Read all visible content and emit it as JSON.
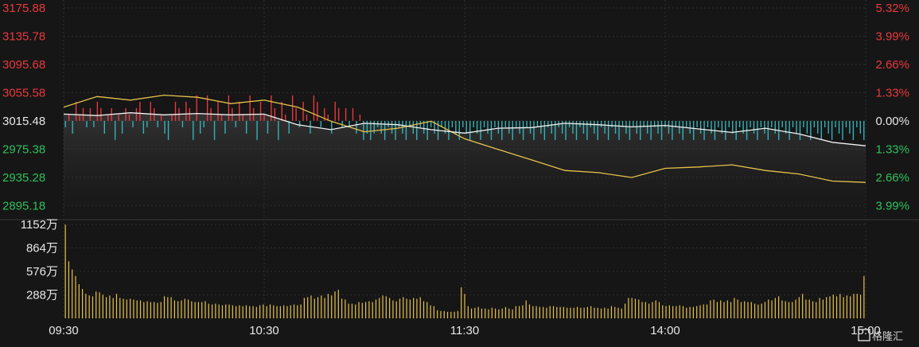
{
  "chart_data": [
    {
      "type": "line",
      "title": "",
      "xlabel": "",
      "ylabel": "",
      "base_price": 3015.48,
      "y_left_ticks": [
        "3175.88",
        "3135.78",
        "3095.68",
        "3055.58",
        "3015.48",
        "2975.38",
        "2935.28",
        "2895.18"
      ],
      "y_right_ticks": [
        "5.32%",
        "3.99%",
        "2.66%",
        "1.33%",
        "0.00%",
        "1.33%",
        "2.66%",
        "3.99%"
      ],
      "x_ticks": [
        "09:30",
        "10:30",
        "11:30",
        "14:00",
        "15:00"
      ],
      "ylim": [
        2875.13,
        3175.88
      ],
      "series": [
        {
          "x": [
            0,
            10,
            20,
            30,
            40,
            50,
            60,
            70,
            80,
            90,
            100,
            110,
            120,
            130,
            140,
            150,
            160,
            170,
            180,
            190,
            200,
            210,
            220,
            230,
            240
          ],
          "values": [
            3035,
            3050,
            3045,
            3052,
            3049,
            3040,
            3045,
            3035,
            3015,
            3000,
            3005,
            3015,
            2990,
            2975,
            2960,
            2945,
            2942,
            2935,
            2948,
            2950,
            2953,
            2945,
            2940,
            2930,
            2928
          ]
        },
        {
          "x": [
            0,
            10,
            20,
            30,
            40,
            50,
            60,
            70,
            80,
            90,
            100,
            110,
            120,
            130,
            140,
            150,
            160,
            170,
            180,
            190,
            200,
            210,
            220,
            230,
            240
          ],
          "values": [
            3025,
            3023,
            3027,
            3024,
            3026,
            3024,
            3025,
            3010,
            3003,
            3012,
            3010,
            3003,
            2998,
            3005,
            3006,
            3012,
            3010,
            3007,
            3009,
            3004,
            2999,
            3005,
            2997,
            2985,
            2980
          ]
        }
      ],
      "breadth_bars": [
        -1,
        1,
        -2,
        3,
        1,
        2,
        -1,
        2,
        -1,
        3,
        2,
        -2,
        1,
        2,
        -3,
        1,
        -2,
        2,
        1,
        -1,
        2,
        3,
        -2,
        -1,
        3,
        2,
        -1,
        1,
        -2,
        -3,
        1,
        3,
        2,
        -1,
        3,
        2,
        -3,
        4,
        -2,
        -1,
        4,
        2,
        -3,
        3,
        1,
        -2,
        4,
        2,
        -1,
        3,
        1,
        -2,
        4,
        2,
        -3,
        3,
        1,
        -2,
        4,
        2,
        -3,
        3,
        1,
        -2,
        4,
        2,
        -1,
        3,
        1,
        -2,
        4,
        3,
        -1,
        2,
        1,
        -2,
        3,
        2,
        -1,
        2,
        -1,
        2,
        -2,
        1,
        -3,
        -2,
        -3,
        -2,
        -1,
        -2,
        -3,
        -1,
        -2,
        -3,
        -1,
        -2,
        -3,
        -1,
        -2,
        -3,
        -1,
        -2,
        -3,
        -1,
        -2,
        -3,
        -1,
        -2,
        -3,
        -1,
        -2,
        -3,
        -1,
        -2,
        -3,
        -1,
        -2,
        -3,
        -1,
        -2,
        -3,
        -1,
        -2,
        -3,
        -1,
        -2,
        -3,
        -1,
        -2,
        -3,
        -1,
        -2,
        -3,
        -1,
        -2,
        -3,
        -1,
        -2,
        -3,
        -1,
        -2,
        -3,
        -1,
        -2,
        -3,
        -1,
        -2,
        -3,
        -1,
        -2,
        -3,
        -1,
        -2,
        -3,
        -1,
        -2,
        -3,
        -1,
        -2,
        -3,
        -1,
        -2,
        -3,
        -1,
        -2,
        -3,
        -1,
        -2,
        -3,
        -1,
        -2,
        -3,
        -1,
        -2,
        -3,
        -1,
        -2,
        -3,
        -1,
        -2,
        -3,
        -1,
        -2,
        -3,
        -1,
        -2,
        -3,
        -1,
        -2,
        -3,
        -1,
        -2,
        -3,
        -1,
        -2,
        -3,
        -1,
        -2,
        -3,
        -1,
        -2,
        -3,
        -1,
        -2,
        -3,
        -1,
        -2,
        -3,
        -1,
        -2,
        -3,
        -1,
        -2,
        -3,
        -1,
        -2,
        -3,
        -1,
        -2,
        -3,
        -1,
        -2,
        -3,
        -1,
        -2,
        -3
      ]
    },
    {
      "type": "bar",
      "title": "",
      "y_ticks": [
        "1152万",
        "864万",
        "576万",
        "288万"
      ],
      "ylim": [
        0,
        1152
      ],
      "values": [
        1150,
        700,
        600,
        520,
        420,
        360,
        300,
        280,
        270,
        330,
        320,
        290,
        260,
        280,
        250,
        300,
        250,
        240,
        230,
        240,
        230,
        220,
        220,
        200,
        210,
        200,
        200,
        190,
        200,
        270,
        260,
        260,
        220,
        210,
        220,
        240,
        230,
        210,
        200,
        200,
        200,
        210,
        180,
        170,
        180,
        170,
        160,
        170,
        170,
        160,
        150,
        160,
        150,
        160,
        150,
        150,
        140,
        160,
        170,
        150,
        170,
        160,
        150,
        150,
        160,
        150,
        160,
        170,
        160,
        170,
        250,
        260,
        280,
        240,
        260,
        280,
        250,
        300,
        280,
        330,
        350,
        240,
        230,
        180,
        180,
        170,
        200,
        190,
        200,
        210,
        200,
        230,
        250,
        280,
        270,
        250,
        220,
        210,
        240,
        260,
        240,
        230,
        250,
        240,
        260,
        210,
        200,
        160,
        150,
        100,
        90,
        90,
        80,
        80,
        80,
        90,
        380,
        300,
        150,
        120,
        130,
        140,
        120,
        120,
        110,
        130,
        120,
        110,
        120,
        140,
        120,
        110,
        150,
        150,
        160,
        220,
        170,
        150,
        150,
        140,
        140,
        130,
        150,
        150,
        140,
        140,
        140,
        130,
        130,
        130,
        140,
        130,
        130,
        140,
        150,
        130,
        130,
        120,
        130,
        120,
        150,
        140,
        130,
        120,
        180,
        250,
        250,
        240,
        230,
        200,
        200,
        180,
        200,
        220,
        200,
        160,
        150,
        160,
        150,
        150,
        160,
        150,
        130,
        140,
        140,
        150,
        160,
        170,
        170,
        220,
        230,
        200,
        220,
        200,
        220,
        200,
        250,
        230,
        200,
        210,
        200,
        200,
        180,
        170,
        180,
        200,
        230,
        220,
        250,
        270,
        220,
        210,
        200,
        200,
        230,
        260,
        300,
        230,
        230,
        210,
        200,
        250,
        230,
        260,
        270,
        290,
        270,
        300,
        260,
        280,
        270,
        300,
        300,
        290,
        520
      ]
    }
  ],
  "watermark": "格隆汇"
}
